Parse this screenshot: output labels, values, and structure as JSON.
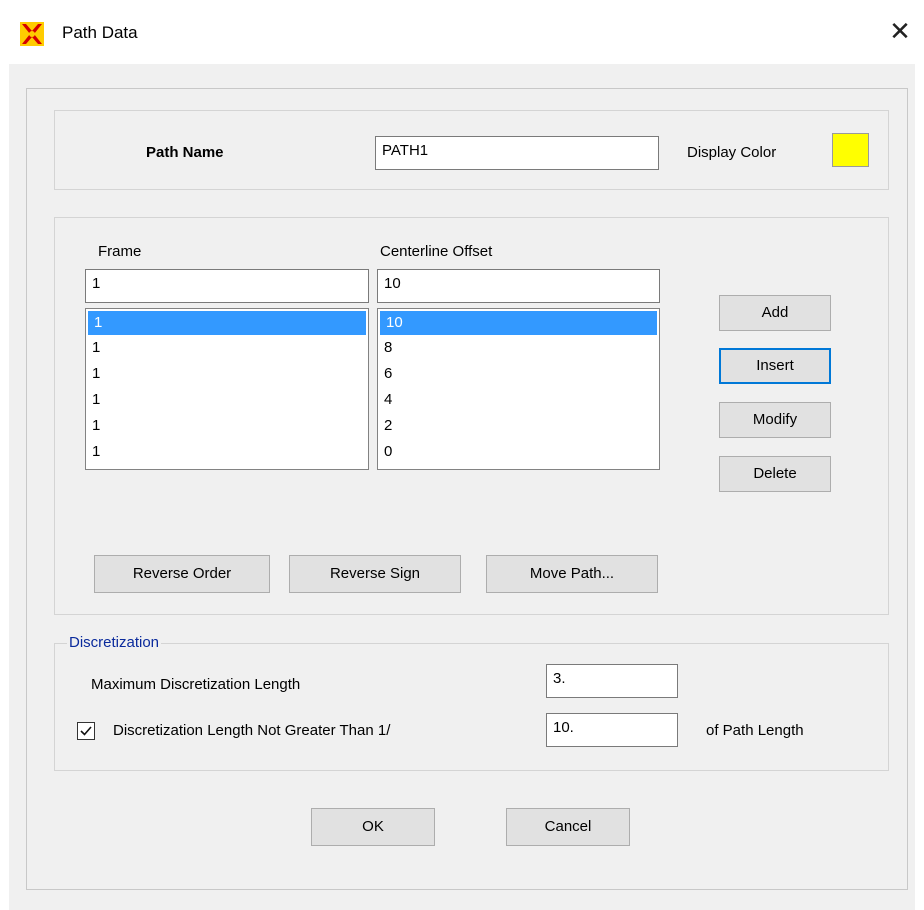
{
  "window": {
    "title": "Path Data",
    "close_glyph": "✕"
  },
  "path": {
    "name_label": "Path Name",
    "name_value": "PATH1",
    "display_color_label": "Display Color",
    "display_color": "#ffff00"
  },
  "table": {
    "frame_header": "Frame",
    "offset_header": "Centerline Offset",
    "frame_input": "1",
    "offset_input": "10",
    "frame_items": [
      "1",
      "1",
      "1",
      "1",
      "1",
      "1"
    ],
    "offset_items": [
      "10",
      "8",
      "6",
      "4",
      "2",
      "0"
    ],
    "selected_index": 0
  },
  "side_buttons": {
    "add": "Add",
    "insert": "Insert",
    "modify": "Modify",
    "delete": "Delete"
  },
  "bottom_buttons": {
    "reverse_order": "Reverse Order",
    "reverse_sign": "Reverse Sign",
    "move_path": "Move Path..."
  },
  "discretization": {
    "title": "Discretization",
    "max_length_label": "Maximum Discretization Length",
    "max_length_value": "3.",
    "not_greater_label": "Discretization Length Not Greater Than  1/",
    "not_greater_checked": true,
    "not_greater_value": "10.",
    "suffix_label": "of Path Length"
  },
  "dialog_buttons": {
    "ok": "OK",
    "cancel": "Cancel"
  },
  "icons": {
    "app": "csi-app-icon",
    "check": "checkmark-icon"
  },
  "colors": {
    "selection": "#3399ff",
    "group_title": "#0a2a9c",
    "focus": "#0078d7"
  }
}
